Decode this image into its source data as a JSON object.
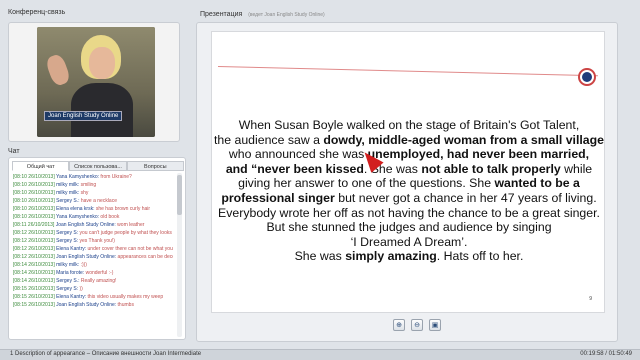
{
  "conference": {
    "title": "Конференц-связь",
    "caption": "Joan English Study Online"
  },
  "chat": {
    "title": "Чат",
    "tabs": [
      "Общий чат",
      "Список пользова...",
      "Вопросы"
    ],
    "messages": [
      {
        "time": "[08:10 26/10/2013]",
        "user": "Yana Kamyshenko:",
        "text": "from Ukraine?"
      },
      {
        "time": "[08:10 26/10/2013]",
        "user": "milky milk:",
        "text": "smiling"
      },
      {
        "time": "[08:10 26/10/2013]",
        "user": "milky milk:",
        "text": "shy"
      },
      {
        "time": "[08:10 26/10/2013]",
        "user": "Sergey S.:",
        "text": "have a necklace"
      },
      {
        "time": "[08:10 26/10/2013]",
        "user": "Elena elena krsk:",
        "text": "she has brown curly hair"
      },
      {
        "time": "[08:10 26/10/2013]",
        "user": "Yana Kamyshenko:",
        "text": "old book"
      },
      {
        "time": "[08:11 26/10/2013]",
        "user": "Joan English Study Online:",
        "text": "wom leather"
      },
      {
        "time": "[08:12 26/10/2013]",
        "user": "Sergey S:",
        "text": "you can't judge people by what they looks like"
      },
      {
        "time": "[08:12 26/10/2013]",
        "user": "Sergey S:",
        "text": "yes Thank you!)"
      },
      {
        "time": "[08:12 26/10/2013]",
        "user": "Elena Kantry:",
        "text": "under cover there can not be what you expect"
      },
      {
        "time": "[08:12 26/10/2013]",
        "user": "Joan English Study Online:",
        "text": "appearances can be deceptive"
      },
      {
        "time": "[08:14 26/10/2013]",
        "user": "milky milk:",
        "text": ":)))"
      },
      {
        "time": "[08:14 26/10/2013]",
        "user": "Maria forote:",
        "text": "wonderful :-)"
      },
      {
        "time": "[08:14 26/10/2013]",
        "user": "Sergey S.:",
        "text": "Really amazing!"
      },
      {
        "time": "[08:15 26/10/2013]",
        "user": "Sergey S:",
        "text": "))"
      },
      {
        "time": "[08:15 26/10/2013]",
        "user": "Elena Kantry:",
        "text": "this video usually makes my weep"
      },
      {
        "time": "[08:15 26/10/2013]",
        "user": "Joan English Study Online:",
        "text": "thumbs"
      }
    ]
  },
  "presentation": {
    "title": "Презентация",
    "subtitle": "(ведет Joan English Study Online)",
    "page_number": "9",
    "slide_lines": [
      [
        {
          "t": "When Susan Boyle walked on the stage of Britain's Got Talent,",
          "s": ""
        }
      ],
      [
        {
          "t": "the audience saw a ",
          "s": ""
        },
        {
          "t": "dowdy, middle-aged woman from a small village",
          "s": "bold"
        }
      ],
      [
        {
          "t": "who announced she was ",
          "s": ""
        },
        {
          "t": "unemployed, had never been married,",
          "s": "bold"
        }
      ],
      [
        {
          "t": "and “never been kissed",
          "s": "bold"
        },
        {
          "t": ". She was ",
          "s": ""
        },
        {
          "t": "not able to talk properly",
          "s": "bold"
        },
        {
          "t": " while",
          "s": ""
        }
      ],
      [
        {
          "t": "giving her answer to one of the questions. She ",
          "s": ""
        },
        {
          "t": "wanted to be a",
          "s": "bold"
        }
      ],
      [
        {
          "t": "professional singer",
          "s": "bold"
        },
        {
          "t": " but never got a chance in her 47 years of living.",
          "s": ""
        }
      ],
      [
        {
          "t": "Everybody wrote her off as not having the chance to be a great singer.",
          "s": ""
        }
      ],
      [
        {
          "t": "But she stunned the judges and audience by singing",
          "s": ""
        }
      ],
      [
        {
          "t": "‘I Dreamed A Dream’.",
          "s": ""
        }
      ],
      [
        {
          "t": "She was ",
          "s": ""
        },
        {
          "t": "simply amazing",
          "s": "bold"
        },
        {
          "t": ". Hats off to her.",
          "s": ""
        }
      ]
    ],
    "controls": [
      "zoom-in-icon",
      "zoom-out-icon",
      "save-icon"
    ]
  },
  "footer": {
    "title": "1 Description of appearance – Описание внешности Joan Intermediate",
    "time": "00:19:58 / 01:50:49"
  }
}
